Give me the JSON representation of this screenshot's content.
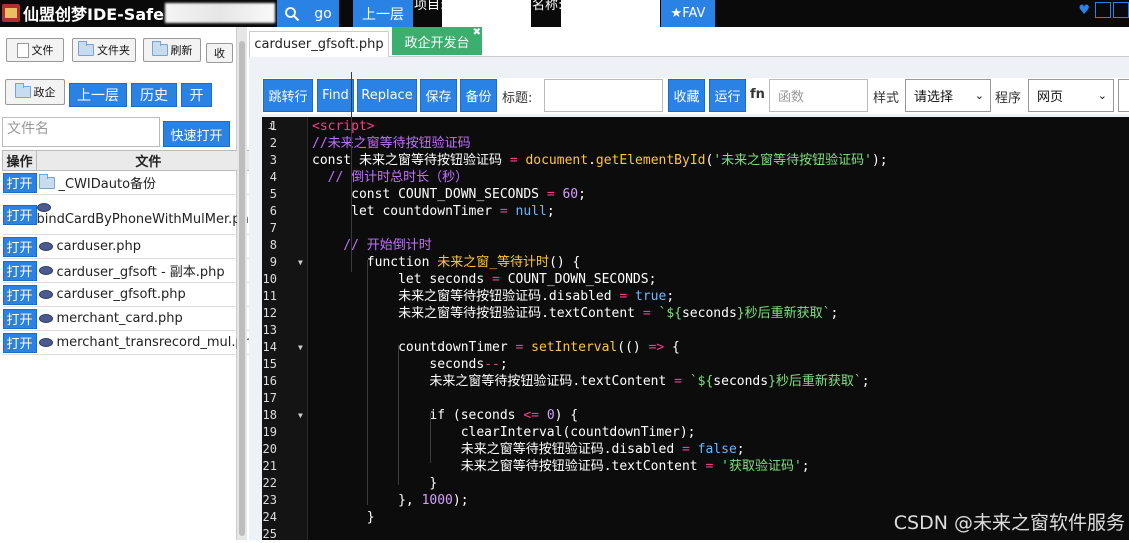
{
  "topbar": {
    "brand": "仙盟创梦IDE-Safe",
    "go_label": "go",
    "up_label": "上一层",
    "project_label": "项目:",
    "name_label": "名称:",
    "fav_label": "★FAV"
  },
  "sidebar": {
    "file_btn": "文件",
    "folder_btn": "文件夹",
    "refresh_btn": "刷新",
    "collapse_btn": "收",
    "zheng_btn": "政企",
    "up_btn": "上一层",
    "history_btn": "历史",
    "open_btn": "开",
    "filename_placeholder": "文件名",
    "quick_open": "快速打开",
    "col_op": "操作",
    "col_file": "文件",
    "open_label": "打开",
    "files": [
      {
        "name": "_CWIDauto备份",
        "kind": "folder"
      },
      {
        "name": "bindCardByPhoneWithMulMer.php",
        "kind": "php"
      },
      {
        "name": "carduser.php",
        "kind": "php"
      },
      {
        "name": "carduser_gfsoft - 副本.php",
        "kind": "php"
      },
      {
        "name": "carduser_gfsoft.php",
        "kind": "php"
      },
      {
        "name": "merchant_card.php",
        "kind": "php"
      },
      {
        "name": "merchant_transrecord_mul.php",
        "kind": "php"
      }
    ]
  },
  "tabs": {
    "active": "carduser_gfsoft.php",
    "second": "政企开发台"
  },
  "toolbar": {
    "goto": "跳转行",
    "find": "Find",
    "replace": "Replace",
    "save": "保存",
    "backup": "备份",
    "title_label": "标题:",
    "collect": "收藏",
    "run": "运行",
    "fn_label": "fn",
    "func_placeholder": "函数",
    "style_label": "样式",
    "style_value": "请选择",
    "program_label": "程序",
    "program_value": "网页"
  },
  "editor": {
    "lines": [
      {
        "n": "1",
        "segs": [
          [
            "tag",
            "<script>"
          ]
        ]
      },
      {
        "n": "2",
        "segs": [
          [
            "cm",
            "//未来之窗等待按钮验证码"
          ]
        ]
      },
      {
        "n": "3",
        "segs": [
          [
            "kw",
            "const "
          ],
          [
            "id",
            "未来之窗等待按钮验证码 "
          ],
          [
            "op",
            "= "
          ],
          [
            "fn",
            "document"
          ],
          [
            "id",
            "."
          ],
          [
            "fn",
            "getElementById"
          ],
          [
            "id",
            "("
          ],
          [
            "str",
            "'未来之窗等待按钮验证码'"
          ],
          [
            "id",
            ");"
          ]
        ]
      },
      {
        "n": "4",
        "segs": [
          [
            "cm",
            "  // 倒计时总时长（秒）"
          ]
        ]
      },
      {
        "n": "5",
        "segs": [
          [
            "kw",
            "     const "
          ],
          [
            "id",
            "COUNT_DOWN_SECONDS "
          ],
          [
            "op",
            "= "
          ],
          [
            "num",
            "60"
          ],
          [
            "id",
            ";"
          ]
        ]
      },
      {
        "n": "6",
        "segs": [
          [
            "kw",
            "     let "
          ],
          [
            "id",
            "countdownTimer "
          ],
          [
            "op",
            "= "
          ],
          [
            "null",
            "null"
          ],
          [
            "id",
            ";"
          ]
        ]
      },
      {
        "n": "7",
        "segs": []
      },
      {
        "n": "8",
        "segs": [
          [
            "cm",
            "    // 开始倒计时"
          ]
        ]
      },
      {
        "n": "9",
        "segs": [
          [
            "kw",
            "       function "
          ],
          [
            "fn",
            "未来之窗_等待计时"
          ],
          [
            "id",
            "() {"
          ]
        ]
      },
      {
        "n": "10",
        "segs": [
          [
            "kw",
            "           let "
          ],
          [
            "id",
            "seconds "
          ],
          [
            "op",
            "= "
          ],
          [
            "id",
            "COUNT_DOWN_SECONDS;"
          ]
        ]
      },
      {
        "n": "11",
        "segs": [
          [
            "id",
            "           未来之窗等待按钮验证码.disabled "
          ],
          [
            "op",
            "= "
          ],
          [
            "bool",
            "true"
          ],
          [
            "id",
            ";"
          ]
        ]
      },
      {
        "n": "12",
        "segs": [
          [
            "id",
            "           未来之窗等待按钮验证码.textContent "
          ],
          [
            "op",
            "= "
          ],
          [
            "str",
            "`${"
          ],
          [
            "id",
            "seconds"
          ],
          [
            "str",
            "}秒后重新获取`"
          ],
          [
            "id",
            ";"
          ]
        ]
      },
      {
        "n": "13",
        "segs": []
      },
      {
        "n": "14",
        "segs": [
          [
            "id",
            "           countdownTimer "
          ],
          [
            "op",
            "= "
          ],
          [
            "fn",
            "setInterval"
          ],
          [
            "id",
            "(() "
          ],
          [
            "op",
            "=> "
          ],
          [
            "id",
            "{"
          ]
        ]
      },
      {
        "n": "15",
        "segs": [
          [
            "id",
            "               seconds"
          ],
          [
            "op",
            "--"
          ],
          [
            "id",
            ";"
          ]
        ]
      },
      {
        "n": "16",
        "segs": [
          [
            "id",
            "               未来之窗等待按钮验证码.textContent "
          ],
          [
            "op",
            "= "
          ],
          [
            "str",
            "`${"
          ],
          [
            "id",
            "seconds"
          ],
          [
            "str",
            "}秒后重新获取`"
          ],
          [
            "id",
            ";"
          ]
        ]
      },
      {
        "n": "17",
        "segs": []
      },
      {
        "n": "18",
        "segs": [
          [
            "kw",
            "               if "
          ],
          [
            "id",
            "(seconds "
          ],
          [
            "op",
            "<= "
          ],
          [
            "num",
            "0"
          ],
          [
            "id",
            ") {"
          ]
        ]
      },
      {
        "n": "19",
        "segs": [
          [
            "id",
            "                   clearInterval(countdownTimer);"
          ]
        ]
      },
      {
        "n": "20",
        "segs": [
          [
            "id",
            "                   未来之窗等待按钮验证码.disabled "
          ],
          [
            "op",
            "= "
          ],
          [
            "bool",
            "false"
          ],
          [
            "id",
            ";"
          ]
        ]
      },
      {
        "n": "21",
        "segs": [
          [
            "id",
            "                   未来之窗等待按钮验证码.textContent "
          ],
          [
            "op",
            "= "
          ],
          [
            "str",
            "'获取验证码'"
          ],
          [
            "id",
            ";"
          ]
        ]
      },
      {
        "n": "22",
        "segs": [
          [
            "id",
            "               }"
          ]
        ]
      },
      {
        "n": "23",
        "segs": [
          [
            "id",
            "           }, "
          ],
          [
            "num",
            "1000"
          ],
          [
            "id",
            ");"
          ]
        ]
      },
      {
        "n": "24",
        "segs": [
          [
            "id",
            "       }"
          ]
        ]
      },
      {
        "n": "25",
        "segs": []
      }
    ]
  },
  "watermark": "CSDN @未来之窗软件服务"
}
